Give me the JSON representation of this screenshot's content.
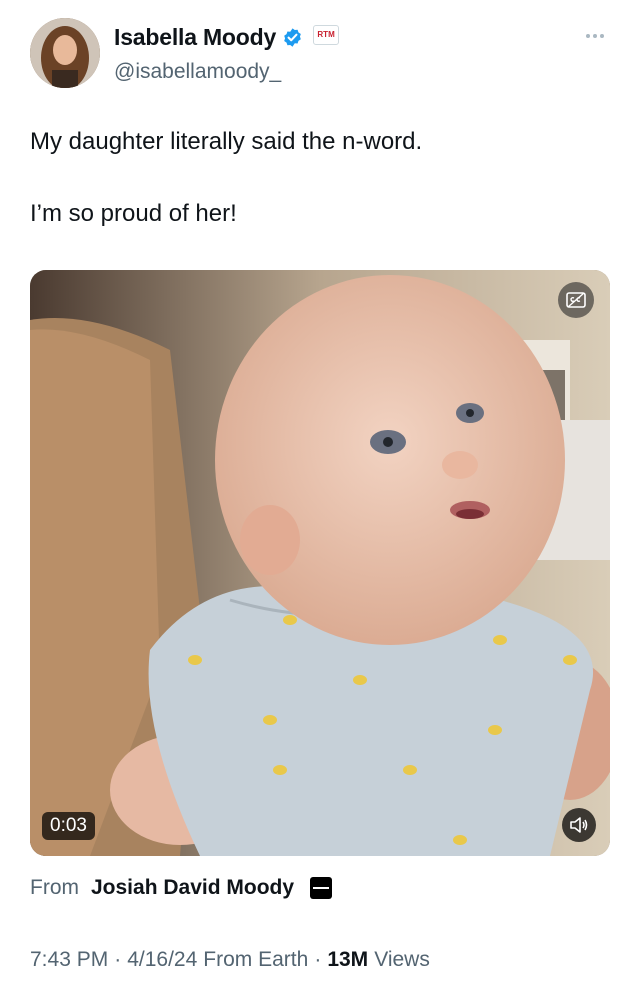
{
  "author": {
    "display_name": "Isabella Moody",
    "handle": "@isabellamoody_",
    "affiliate_badge_text": "RTM"
  },
  "tweet": {
    "line1": "My daughter literally said the n-word.",
    "line2": "I’m so proud of her!"
  },
  "media": {
    "duration": "0:03",
    "caption_icon": "closed-captions-icon",
    "mute_icon": "speaker-icon"
  },
  "source": {
    "from_label": "From",
    "from_name": "Josiah David Moody"
  },
  "meta": {
    "time": "7:43 PM",
    "date": "4/16/24",
    "client": "From Earth",
    "separator": "·",
    "views_count": "13M",
    "views_label": "Views"
  },
  "colors": {
    "verified": "#1d9bf0",
    "secondary_text": "#536471",
    "primary_text": "#0f1419"
  }
}
